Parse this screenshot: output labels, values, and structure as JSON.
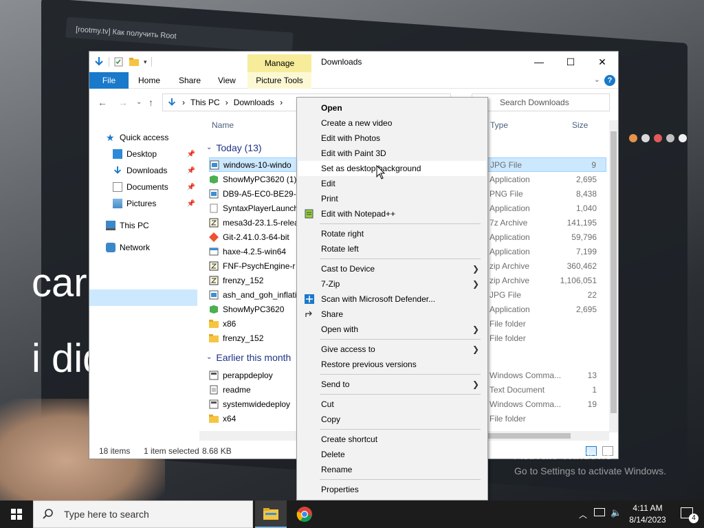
{
  "wallpaper": {
    "browser_tab_text": "[rootmy.tv] Как получить Root",
    "overlay_text_1": "car",
    "overlay_text_2": "i did"
  },
  "explorer": {
    "title": "Downloads",
    "manage_tab": "Manage",
    "ribbon": {
      "file": "File",
      "home": "Home",
      "share": "Share",
      "view": "View",
      "picture_tools": "Picture Tools"
    },
    "window_controls": {
      "minimize": "—",
      "maximize": "☐",
      "close": "✕"
    },
    "address": {
      "this_pc": "This PC",
      "downloads": "Downloads"
    },
    "search_placeholder": "Search Downloads",
    "nav": {
      "quick_access": "Quick access",
      "desktop": "Desktop",
      "downloads": "Downloads",
      "documents": "Documents",
      "pictures": "Pictures",
      "this_pc": "This PC",
      "network": "Network"
    },
    "columns": {
      "name": "Name",
      "type": "Type",
      "size": "Size"
    },
    "groups": {
      "today": "Today (13)",
      "earlier": "Earlier this month"
    },
    "files_today": [
      {
        "name": "windows-10-windo",
        "type": "JPG File",
        "size": "9",
        "icon": "image-file-icon",
        "selected": true
      },
      {
        "name": "ShowMyPC3620 (1)",
        "type": "Application",
        "size": "2,695",
        "icon": "app-green-icon"
      },
      {
        "name": "DB9-A5-EC0-BE29-4",
        "type": "PNG File",
        "size": "8,438",
        "icon": "image-file-icon"
      },
      {
        "name": "SyntaxPlayerLaunch",
        "type": "Application",
        "size": "1,040",
        "icon": "blank-file-icon"
      },
      {
        "name": "mesa3d-23.1.5-relea",
        "type": "7z Archive",
        "size": "141,195",
        "icon": "archive-icon"
      },
      {
        "name": "Git-2.41.0.3-64-bit",
        "type": "Application",
        "size": "59,796",
        "icon": "git-icon"
      },
      {
        "name": "haxe-4.2.5-win64",
        "type": "Application",
        "size": "7,199",
        "icon": "app-icon"
      },
      {
        "name": "FNF-PsychEngine-r",
        "type": "zip Archive",
        "size": "360,462",
        "icon": "archive-icon"
      },
      {
        "name": "frenzy_152",
        "type": "zip Archive",
        "size": "1,106,051",
        "icon": "archive-icon"
      },
      {
        "name": "ash_and_goh_inflati",
        "type": "JPG File",
        "size": "22",
        "icon": "image-file-icon"
      },
      {
        "name": "ShowMyPC3620",
        "type": "Application",
        "size": "2,695",
        "icon": "app-green-icon"
      },
      {
        "name": "x86",
        "type": "File folder",
        "size": "",
        "icon": "folder-icon"
      },
      {
        "name": "frenzy_152",
        "type": "File folder",
        "size": "",
        "icon": "folder-icon"
      }
    ],
    "files_earlier": [
      {
        "name": "perappdeploy",
        "type": "Windows Comma...",
        "size": "13",
        "icon": "cmd-file-icon"
      },
      {
        "name": "readme",
        "type": "Text Document",
        "size": "1",
        "icon": "text-file-icon"
      },
      {
        "name": "systemwidedeploy",
        "type": "Windows Comma...",
        "size": "19",
        "icon": "cmd-file-icon"
      },
      {
        "name": "x64",
        "type": "File folder",
        "size": "",
        "icon": "folder-icon"
      }
    ],
    "status": {
      "items": "18 items",
      "selected": "1 item selected",
      "size": "8.68 KB"
    }
  },
  "context_menu": {
    "items": [
      {
        "label": "Open",
        "bold": true
      },
      {
        "label": "Create a new video"
      },
      {
        "label": "Edit with Photos"
      },
      {
        "label": "Edit with Paint 3D"
      },
      {
        "label": "Set as desktop background",
        "hover": true
      },
      {
        "label": "Edit"
      },
      {
        "label": "Print"
      },
      {
        "label": "Edit with Notepad++",
        "icon": "notepad-plus-icon"
      },
      {
        "sep": true
      },
      {
        "label": "Rotate right"
      },
      {
        "label": "Rotate left"
      },
      {
        "sep": true
      },
      {
        "label": "Cast to Device",
        "submenu": true
      },
      {
        "label": "7-Zip",
        "submenu": true
      },
      {
        "label": "Scan with Microsoft Defender...",
        "icon": "defender-shield-icon"
      },
      {
        "label": "Share",
        "icon": "share-icon"
      },
      {
        "label": "Open with",
        "submenu": true
      },
      {
        "sep": true
      },
      {
        "label": "Give access to",
        "submenu": true
      },
      {
        "label": "Restore previous versions"
      },
      {
        "sep": true
      },
      {
        "label": "Send to",
        "submenu": true
      },
      {
        "sep": true
      },
      {
        "label": "Cut"
      },
      {
        "label": "Copy"
      },
      {
        "sep": true
      },
      {
        "label": "Create shortcut"
      },
      {
        "label": "Delete"
      },
      {
        "label": "Rename"
      },
      {
        "sep": true
      },
      {
        "label": "Properties"
      }
    ]
  },
  "watermark": {
    "title": "Activate Windows",
    "subtitle": "Go to Settings to activate Windows."
  },
  "taskbar": {
    "search_placeholder": "Type here to search",
    "time": "4:11 AM",
    "date": "8/14/2023",
    "notification_count": "4"
  },
  "colors": {
    "accent": "#1979ca",
    "selection": "#cce8ff",
    "manage_tab": "#f7ec9a",
    "taskbar": "#1c1c1c"
  }
}
